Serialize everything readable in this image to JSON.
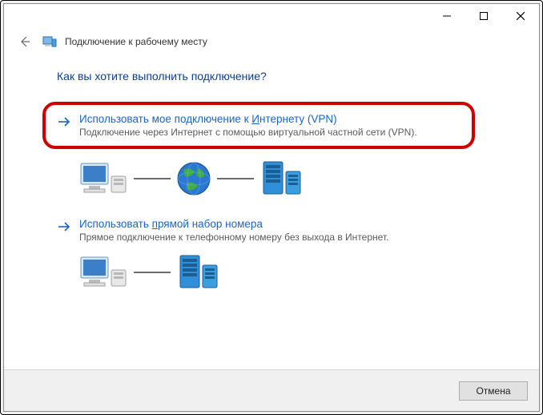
{
  "titlebar": {
    "minimize": "minimize",
    "maximize": "maximize",
    "close": "close"
  },
  "wizard": {
    "title": "Подключение к рабочему месту"
  },
  "heading": "Как вы хотите выполнить подключение?",
  "option_vpn": {
    "title_pre": "Использовать мое подключение к ",
    "title_ul": "И",
    "title_post": "нтернету (VPN)",
    "desc": "Подключение через Интернет с помощью виртуальной частной сети (VPN)."
  },
  "option_dial": {
    "title_pre": "Использовать ",
    "title_ul": "п",
    "title_post": "рямой набор номера",
    "desc": "Прямое подключение к телефонному номеру без выхода в Интернет."
  },
  "footer": {
    "cancel": "Отмена"
  }
}
